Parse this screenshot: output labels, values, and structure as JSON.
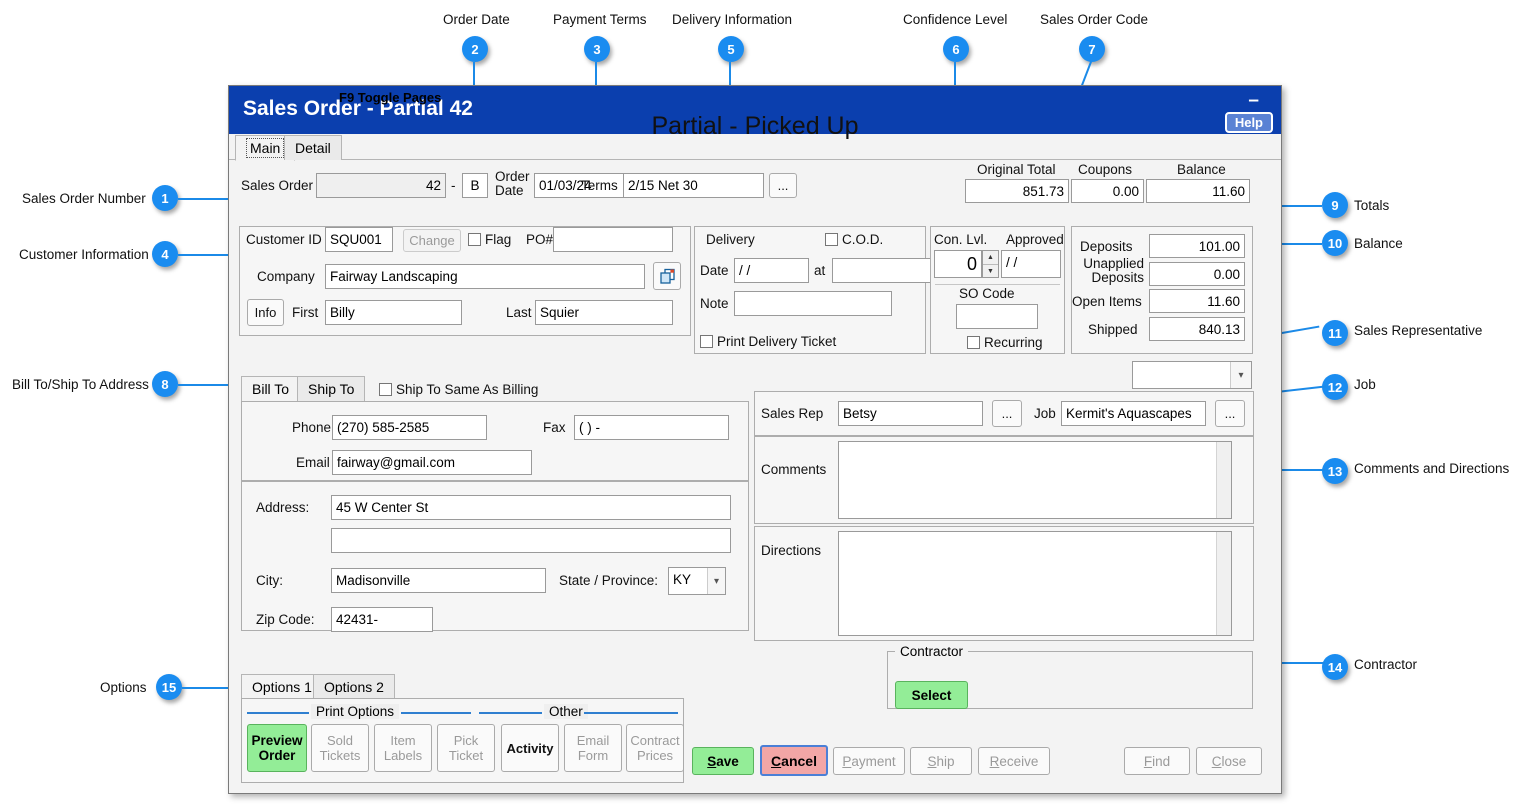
{
  "window": {
    "title": "Sales Order - Partial 42",
    "help_label": "Help",
    "minimize_label": "–",
    "status_text": "Partial - Picked Up"
  },
  "tabs": {
    "main": "Main",
    "detail": "Detail",
    "toggle_hint": "F9 Toggle Pages"
  },
  "order": {
    "sales_order_label": "Sales Order",
    "sales_order_number": "42",
    "dash": "-",
    "sales_order_suffix": "B",
    "order_date_label": "Order Date",
    "order_date": "01/03/24",
    "terms_label": "Terms",
    "terms": "2/15 Net 30",
    "terms_browse": "..."
  },
  "totals": {
    "original_total_label": "Original Total",
    "original_total": "851.73",
    "coupons_label": "Coupons",
    "coupons": "0.00",
    "balance_label": "Balance",
    "balance": "11.60",
    "deposits_label": "Deposits",
    "deposits": "101.00",
    "unapplied_deposits_label": "Unapplied Deposits",
    "unapplied_deposits": "0.00",
    "open_items_label": "Open Items",
    "open_items": "11.60",
    "shipped_label": "Shipped",
    "shipped": "840.13"
  },
  "customer": {
    "customer_id_label": "Customer ID",
    "customer_id": "SQU001",
    "change_label": "Change",
    "flag_label": "Flag",
    "flag_checked": false,
    "po_label": "PO#",
    "po_value": "",
    "company_label": "Company",
    "company": "Fairway Landscaping",
    "copy_icon": "copy-icon",
    "info_label": "Info",
    "first_label": "First",
    "first": "Billy",
    "last_label": "Last",
    "last": "Squier"
  },
  "delivery": {
    "title": "Delivery",
    "cod_label": "C.O.D.",
    "cod_checked": false,
    "date_label": "Date",
    "date": "/  /",
    "at_label": "at",
    "at_time": "",
    "note_label": "Note",
    "note": "",
    "print_ticket_label": "Print Delivery Ticket",
    "print_ticket_checked": false
  },
  "confidence": {
    "con_lvl_label": "Con. Lvl.",
    "con_lvl_value": "0",
    "approved_label": "Approved",
    "approved_date": "/  /",
    "so_code_label": "SO Code",
    "so_code": "",
    "recurring_label": "Recurring",
    "recurring_checked": false
  },
  "address": {
    "bill_to_tab": "Bill To",
    "ship_to_tab": "Ship To",
    "same_as_billing_label": "Ship To Same As Billing",
    "same_as_billing_checked": false,
    "phone_label": "Phone",
    "phone": "(270) 585-2585",
    "fax_label": "Fax",
    "fax": "(    )      -",
    "email_label": "Email",
    "email": "fairway@gmail.com",
    "address_label": "Address:",
    "address1": "45 W Center St",
    "address2": "",
    "city_label": "City:",
    "city": "Madisonville",
    "state_label": "State / Province:",
    "state": "KY",
    "zip_label": "Zip Code:",
    "zip": "42431-"
  },
  "rep": {
    "top_select_value": "",
    "sales_rep_label": "Sales Rep",
    "sales_rep": "Betsy",
    "sales_rep_browse": "...",
    "job_label": "Job",
    "job": "Kermit's Aquascapes",
    "job_browse": "...",
    "comments_label": "Comments",
    "comments": "",
    "directions_label": "Directions",
    "directions": ""
  },
  "options": {
    "tab1": "Options 1",
    "tab2": "Options 2",
    "print_options_label": "Print Options",
    "other_label": "Other",
    "buttons": [
      {
        "label": "Preview Order",
        "style": "green"
      },
      {
        "label": "Sold Tickets",
        "style": "disabled"
      },
      {
        "label": "Item Labels",
        "style": "disabled"
      },
      {
        "label": "Pick Ticket",
        "style": "disabled"
      },
      {
        "label": "Activity",
        "style": "normal"
      },
      {
        "label": "Email Form",
        "style": "disabled"
      },
      {
        "label": "Contract Prices",
        "style": "disabled"
      }
    ]
  },
  "contractor": {
    "title": "Contractor",
    "select_label": "Select"
  },
  "actions": {
    "save": "Save",
    "cancel": "Cancel",
    "payment": "Payment",
    "ship": "Ship",
    "receive": "Receive",
    "find": "Find",
    "close": "Close"
  },
  "annotations": [
    {
      "n": "1",
      "label": "Sales Order Number"
    },
    {
      "n": "2",
      "label": "Order Date"
    },
    {
      "n": "3",
      "label": "Payment Terms"
    },
    {
      "n": "4",
      "label": "Customer Information"
    },
    {
      "n": "5",
      "label": "Delivery Information"
    },
    {
      "n": "6",
      "label": "Confidence Level"
    },
    {
      "n": "7",
      "label": "Sales Order Code"
    },
    {
      "n": "8",
      "label": "Bill To/Ship To Address"
    },
    {
      "n": "9",
      "label": "Totals"
    },
    {
      "n": "10",
      "label": "Balance"
    },
    {
      "n": "11",
      "label": "Sales Representative"
    },
    {
      "n": "12",
      "label": "Job"
    },
    {
      "n": "13",
      "label": "Comments and Directions"
    },
    {
      "n": "14",
      "label": "Contractor"
    },
    {
      "n": "15",
      "label": "Options"
    }
  ]
}
